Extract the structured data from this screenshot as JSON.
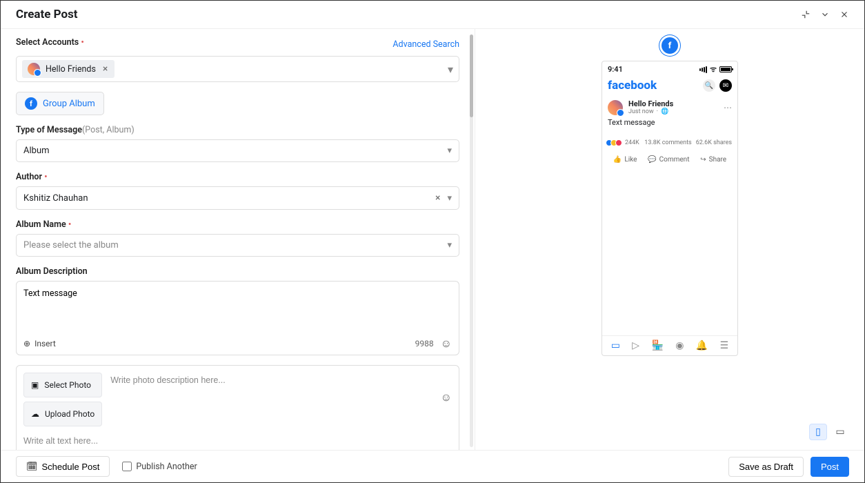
{
  "header": {
    "title": "Create Post"
  },
  "accounts": {
    "label": "Select Accounts",
    "advanced_search": "Advanced Search",
    "chip_label": "Hello Friends"
  },
  "group_album": {
    "label": "Group Album"
  },
  "message_type": {
    "label": "Type of Message",
    "hint": "(Post, Album)",
    "value": "Album"
  },
  "author": {
    "label": "Author",
    "value": "Kshitiz Chauhan"
  },
  "album_name": {
    "label": "Album Name",
    "placeholder": "Please select the album"
  },
  "album_desc": {
    "label": "Album Description",
    "value": "Text message",
    "insert": "Insert",
    "counter": "9988",
    "photo_desc_placeholder": "Write photo description here...",
    "select_photo": "Select Photo",
    "upload_photo": "Upload Photo",
    "alt_placeholder": "Write alt text here..."
  },
  "footer": {
    "schedule": "Schedule Post",
    "publish_another": "Publish Another",
    "save_draft": "Save as Draft",
    "post": "Post"
  },
  "preview": {
    "time": "9:41",
    "logo": "facebook",
    "account_name": "Hello Friends",
    "posted": "Just now",
    "text": "Text message",
    "react_count": "244K",
    "comments": "13.8K comments",
    "shares": "62.6K shares",
    "like": "Like",
    "comment": "Comment",
    "share": "Share"
  }
}
